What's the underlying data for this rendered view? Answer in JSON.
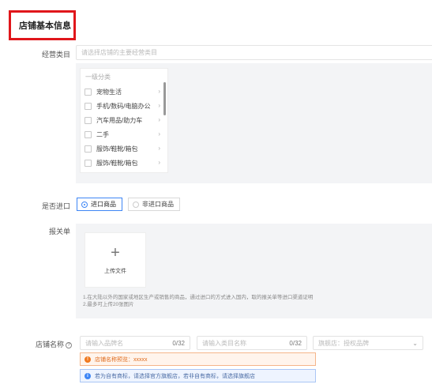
{
  "section": {
    "title": "店铺基本信息"
  },
  "category": {
    "label": "经营类目",
    "placeholder": "请选择店铺的主要经营类目",
    "list_header": "一级分类",
    "items": [
      "宠物生活",
      "手机/数码/电脑办公",
      "汽车用品/助力车",
      "二手",
      "服饰/鞋靴/箱包",
      "服饰/鞋靴/箱包"
    ]
  },
  "import": {
    "label": "是否进口",
    "options": [
      "进口商品",
      "非进口商品"
    ],
    "selected": "进口商品"
  },
  "customs": {
    "label": "报关单",
    "upload_label": "上传文件",
    "note_line1": "1.在大陆以外的国家或地区生产或销售的商品，通过进口的方式进入国内，取的报关单等进口渠道证明",
    "note_line2": "2.最多可上传20张图片"
  },
  "store_name": {
    "label": "店铺名称",
    "brand_placeholder": "请输入品牌名",
    "brand_count": "0/32",
    "category_placeholder": "请输入类目名称",
    "category_count": "0/32",
    "type_placeholder": "旗舰店：授权品牌",
    "preview_alert": "店铺名称预览：xxxxx",
    "info_alert": "若为自有商标，请选择官方旗舰店，若非自有商标，请选择旗舰店"
  },
  "colors": {
    "accent": "#3e86f5",
    "highlight": "#e0161b",
    "warning": "#f0781e"
  }
}
